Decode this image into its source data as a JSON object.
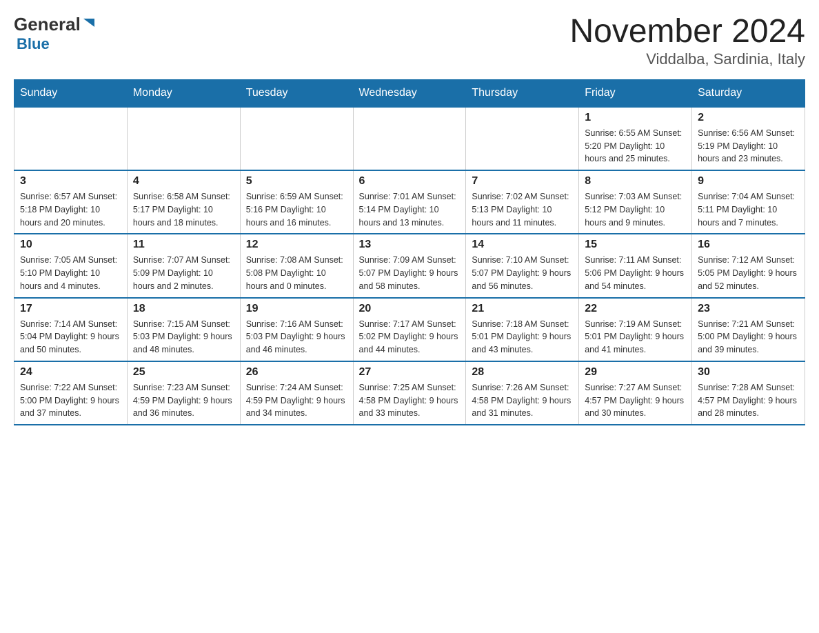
{
  "header": {
    "logo_general": "General",
    "logo_blue": "Blue",
    "title": "November 2024",
    "subtitle": "Viddalba, Sardinia, Italy"
  },
  "weekdays": [
    "Sunday",
    "Monday",
    "Tuesday",
    "Wednesday",
    "Thursday",
    "Friday",
    "Saturday"
  ],
  "weeks": [
    [
      {
        "day": "",
        "info": ""
      },
      {
        "day": "",
        "info": ""
      },
      {
        "day": "",
        "info": ""
      },
      {
        "day": "",
        "info": ""
      },
      {
        "day": "",
        "info": ""
      },
      {
        "day": "1",
        "info": "Sunrise: 6:55 AM\nSunset: 5:20 PM\nDaylight: 10 hours\nand 25 minutes."
      },
      {
        "day": "2",
        "info": "Sunrise: 6:56 AM\nSunset: 5:19 PM\nDaylight: 10 hours\nand 23 minutes."
      }
    ],
    [
      {
        "day": "3",
        "info": "Sunrise: 6:57 AM\nSunset: 5:18 PM\nDaylight: 10 hours\nand 20 minutes."
      },
      {
        "day": "4",
        "info": "Sunrise: 6:58 AM\nSunset: 5:17 PM\nDaylight: 10 hours\nand 18 minutes."
      },
      {
        "day": "5",
        "info": "Sunrise: 6:59 AM\nSunset: 5:16 PM\nDaylight: 10 hours\nand 16 minutes."
      },
      {
        "day": "6",
        "info": "Sunrise: 7:01 AM\nSunset: 5:14 PM\nDaylight: 10 hours\nand 13 minutes."
      },
      {
        "day": "7",
        "info": "Sunrise: 7:02 AM\nSunset: 5:13 PM\nDaylight: 10 hours\nand 11 minutes."
      },
      {
        "day": "8",
        "info": "Sunrise: 7:03 AM\nSunset: 5:12 PM\nDaylight: 10 hours\nand 9 minutes."
      },
      {
        "day": "9",
        "info": "Sunrise: 7:04 AM\nSunset: 5:11 PM\nDaylight: 10 hours\nand 7 minutes."
      }
    ],
    [
      {
        "day": "10",
        "info": "Sunrise: 7:05 AM\nSunset: 5:10 PM\nDaylight: 10 hours\nand 4 minutes."
      },
      {
        "day": "11",
        "info": "Sunrise: 7:07 AM\nSunset: 5:09 PM\nDaylight: 10 hours\nand 2 minutes."
      },
      {
        "day": "12",
        "info": "Sunrise: 7:08 AM\nSunset: 5:08 PM\nDaylight: 10 hours\nand 0 minutes."
      },
      {
        "day": "13",
        "info": "Sunrise: 7:09 AM\nSunset: 5:07 PM\nDaylight: 9 hours\nand 58 minutes."
      },
      {
        "day": "14",
        "info": "Sunrise: 7:10 AM\nSunset: 5:07 PM\nDaylight: 9 hours\nand 56 minutes."
      },
      {
        "day": "15",
        "info": "Sunrise: 7:11 AM\nSunset: 5:06 PM\nDaylight: 9 hours\nand 54 minutes."
      },
      {
        "day": "16",
        "info": "Sunrise: 7:12 AM\nSunset: 5:05 PM\nDaylight: 9 hours\nand 52 minutes."
      }
    ],
    [
      {
        "day": "17",
        "info": "Sunrise: 7:14 AM\nSunset: 5:04 PM\nDaylight: 9 hours\nand 50 minutes."
      },
      {
        "day": "18",
        "info": "Sunrise: 7:15 AM\nSunset: 5:03 PM\nDaylight: 9 hours\nand 48 minutes."
      },
      {
        "day": "19",
        "info": "Sunrise: 7:16 AM\nSunset: 5:03 PM\nDaylight: 9 hours\nand 46 minutes."
      },
      {
        "day": "20",
        "info": "Sunrise: 7:17 AM\nSunset: 5:02 PM\nDaylight: 9 hours\nand 44 minutes."
      },
      {
        "day": "21",
        "info": "Sunrise: 7:18 AM\nSunset: 5:01 PM\nDaylight: 9 hours\nand 43 minutes."
      },
      {
        "day": "22",
        "info": "Sunrise: 7:19 AM\nSunset: 5:01 PM\nDaylight: 9 hours\nand 41 minutes."
      },
      {
        "day": "23",
        "info": "Sunrise: 7:21 AM\nSunset: 5:00 PM\nDaylight: 9 hours\nand 39 minutes."
      }
    ],
    [
      {
        "day": "24",
        "info": "Sunrise: 7:22 AM\nSunset: 5:00 PM\nDaylight: 9 hours\nand 37 minutes."
      },
      {
        "day": "25",
        "info": "Sunrise: 7:23 AM\nSunset: 4:59 PM\nDaylight: 9 hours\nand 36 minutes."
      },
      {
        "day": "26",
        "info": "Sunrise: 7:24 AM\nSunset: 4:59 PM\nDaylight: 9 hours\nand 34 minutes."
      },
      {
        "day": "27",
        "info": "Sunrise: 7:25 AM\nSunset: 4:58 PM\nDaylight: 9 hours\nand 33 minutes."
      },
      {
        "day": "28",
        "info": "Sunrise: 7:26 AM\nSunset: 4:58 PM\nDaylight: 9 hours\nand 31 minutes."
      },
      {
        "day": "29",
        "info": "Sunrise: 7:27 AM\nSunset: 4:57 PM\nDaylight: 9 hours\nand 30 minutes."
      },
      {
        "day": "30",
        "info": "Sunrise: 7:28 AM\nSunset: 4:57 PM\nDaylight: 9 hours\nand 28 minutes."
      }
    ]
  ],
  "colors": {
    "header_bg": "#1a6fa8",
    "accent_blue": "#1a6fa8"
  }
}
